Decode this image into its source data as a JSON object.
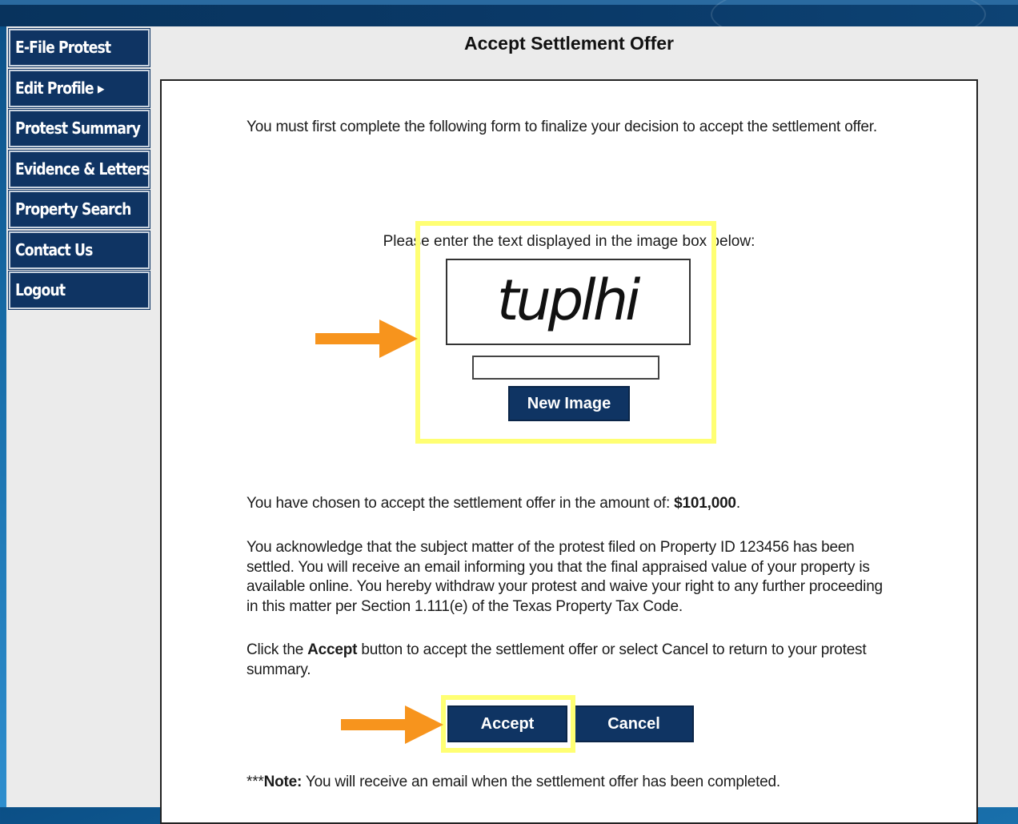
{
  "sidebar": {
    "items": [
      {
        "label": "E-File Protest"
      },
      {
        "label": "Edit Profile ▸"
      },
      {
        "label": "Protest Summary"
      },
      {
        "label": "Evidence & Letters"
      },
      {
        "label": "Property Search"
      },
      {
        "label": "Contact Us"
      },
      {
        "label": "Logout"
      }
    ]
  },
  "page": {
    "title": "Accept Settlement Offer",
    "intro": "You must first complete the following form to finalize your decision to accept the settlement offer.",
    "captcha": {
      "prompt": "Please enter the text displayed in the image box below:",
      "image_text": "tuplhi",
      "input_value": "",
      "new_image_label": "New Image"
    },
    "amount_prefix": "You have chosen to accept the settlement offer in the amount of: ",
    "amount": "$101,000",
    "amount_suffix": ".",
    "acknowledgement": "You acknowledge that the subject matter of the protest filed on Property ID 123456 has been settled. You will receive an email informing you that the final appraised value of your property is available online. You hereby withdraw your protest and waive your right to any further proceeding in this matter per Section 1.111(e) of the Texas Property Tax Code.",
    "click_prefix": "Click the ",
    "click_bold": "Accept",
    "click_suffix": " button to accept the settlement offer or select Cancel to return to your protest summary.",
    "accept_label": "Accept",
    "cancel_label": "Cancel",
    "note_prefix": "***",
    "note_bold": "Note:",
    "note_text": " You will receive an email when the settlement offer has been completed."
  },
  "annotations": {
    "highlight_color": "#ffff73",
    "arrow_color": "#f7941d"
  }
}
